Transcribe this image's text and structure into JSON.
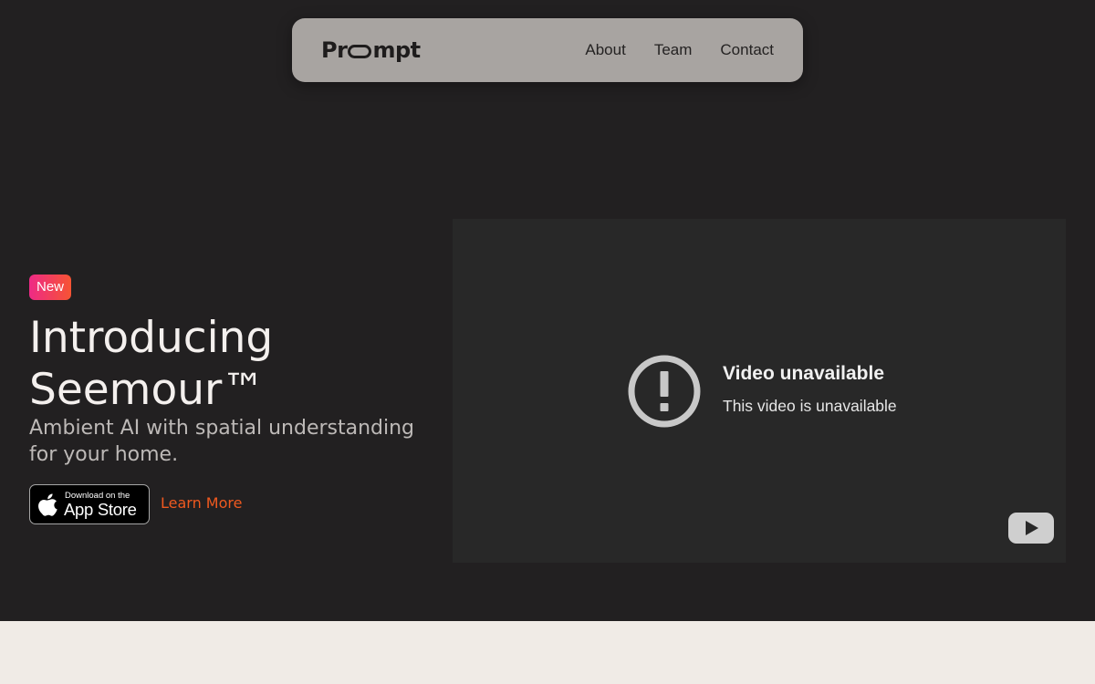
{
  "nav": {
    "logo_left": "Pr",
    "logo_right": "mpt",
    "links": [
      {
        "label": "About"
      },
      {
        "label": "Team"
      },
      {
        "label": "Contact"
      }
    ]
  },
  "hero": {
    "badge": "New",
    "headline_line1": "Introducing",
    "headline_line2": "Seemour™",
    "subhead": "Ambient AI with spatial understanding for your home.",
    "appstore_small": "Download on the",
    "appstore_big": "App Store",
    "learn_more": "Learn More"
  },
  "video": {
    "title": "Video unavailable",
    "message": "This video is unavailable"
  },
  "colors": {
    "hero_bg": "#222021",
    "nav_bg": "#a8a4a1",
    "accent": "#f0591f",
    "badge_gradient_start": "#ee2a86",
    "badge_gradient_end": "#f65433",
    "page_bg": "#f0ebe6",
    "video_bg": "#282828"
  },
  "icons": [
    "apple-icon",
    "alert-icon",
    "youtube-logo-icon"
  ]
}
